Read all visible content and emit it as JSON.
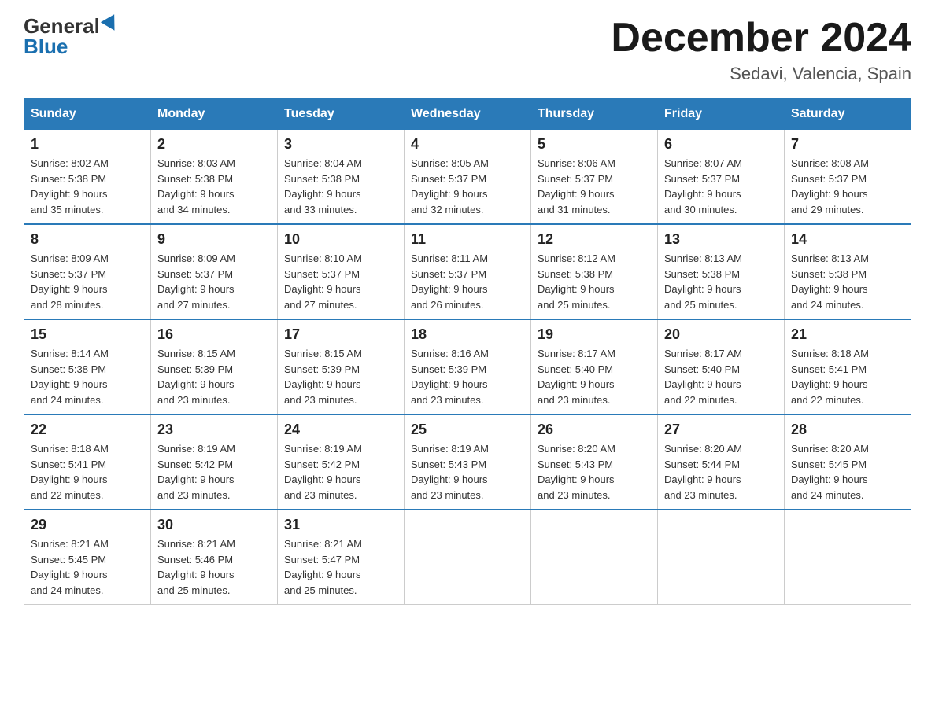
{
  "logo": {
    "general": "General",
    "blue": "Blue"
  },
  "title": {
    "month_year": "December 2024",
    "location": "Sedavi, Valencia, Spain"
  },
  "headers": [
    "Sunday",
    "Monday",
    "Tuesday",
    "Wednesday",
    "Thursday",
    "Friday",
    "Saturday"
  ],
  "weeks": [
    [
      {
        "num": "1",
        "sunrise": "8:02 AM",
        "sunset": "5:38 PM",
        "daylight": "9 hours and 35 minutes."
      },
      {
        "num": "2",
        "sunrise": "8:03 AM",
        "sunset": "5:38 PM",
        "daylight": "9 hours and 34 minutes."
      },
      {
        "num": "3",
        "sunrise": "8:04 AM",
        "sunset": "5:38 PM",
        "daylight": "9 hours and 33 minutes."
      },
      {
        "num": "4",
        "sunrise": "8:05 AM",
        "sunset": "5:37 PM",
        "daylight": "9 hours and 32 minutes."
      },
      {
        "num": "5",
        "sunrise": "8:06 AM",
        "sunset": "5:37 PM",
        "daylight": "9 hours and 31 minutes."
      },
      {
        "num": "6",
        "sunrise": "8:07 AM",
        "sunset": "5:37 PM",
        "daylight": "9 hours and 30 minutes."
      },
      {
        "num": "7",
        "sunrise": "8:08 AM",
        "sunset": "5:37 PM",
        "daylight": "9 hours and 29 minutes."
      }
    ],
    [
      {
        "num": "8",
        "sunrise": "8:09 AM",
        "sunset": "5:37 PM",
        "daylight": "9 hours and 28 minutes."
      },
      {
        "num": "9",
        "sunrise": "8:09 AM",
        "sunset": "5:37 PM",
        "daylight": "9 hours and 27 minutes."
      },
      {
        "num": "10",
        "sunrise": "8:10 AM",
        "sunset": "5:37 PM",
        "daylight": "9 hours and 27 minutes."
      },
      {
        "num": "11",
        "sunrise": "8:11 AM",
        "sunset": "5:37 PM",
        "daylight": "9 hours and 26 minutes."
      },
      {
        "num": "12",
        "sunrise": "8:12 AM",
        "sunset": "5:38 PM",
        "daylight": "9 hours and 25 minutes."
      },
      {
        "num": "13",
        "sunrise": "8:13 AM",
        "sunset": "5:38 PM",
        "daylight": "9 hours and 25 minutes."
      },
      {
        "num": "14",
        "sunrise": "8:13 AM",
        "sunset": "5:38 PM",
        "daylight": "9 hours and 24 minutes."
      }
    ],
    [
      {
        "num": "15",
        "sunrise": "8:14 AM",
        "sunset": "5:38 PM",
        "daylight": "9 hours and 24 minutes."
      },
      {
        "num": "16",
        "sunrise": "8:15 AM",
        "sunset": "5:39 PM",
        "daylight": "9 hours and 23 minutes."
      },
      {
        "num": "17",
        "sunrise": "8:15 AM",
        "sunset": "5:39 PM",
        "daylight": "9 hours and 23 minutes."
      },
      {
        "num": "18",
        "sunrise": "8:16 AM",
        "sunset": "5:39 PM",
        "daylight": "9 hours and 23 minutes."
      },
      {
        "num": "19",
        "sunrise": "8:17 AM",
        "sunset": "5:40 PM",
        "daylight": "9 hours and 23 minutes."
      },
      {
        "num": "20",
        "sunrise": "8:17 AM",
        "sunset": "5:40 PM",
        "daylight": "9 hours and 22 minutes."
      },
      {
        "num": "21",
        "sunrise": "8:18 AM",
        "sunset": "5:41 PM",
        "daylight": "9 hours and 22 minutes."
      }
    ],
    [
      {
        "num": "22",
        "sunrise": "8:18 AM",
        "sunset": "5:41 PM",
        "daylight": "9 hours and 22 minutes."
      },
      {
        "num": "23",
        "sunrise": "8:19 AM",
        "sunset": "5:42 PM",
        "daylight": "9 hours and 23 minutes."
      },
      {
        "num": "24",
        "sunrise": "8:19 AM",
        "sunset": "5:42 PM",
        "daylight": "9 hours and 23 minutes."
      },
      {
        "num": "25",
        "sunrise": "8:19 AM",
        "sunset": "5:43 PM",
        "daylight": "9 hours and 23 minutes."
      },
      {
        "num": "26",
        "sunrise": "8:20 AM",
        "sunset": "5:43 PM",
        "daylight": "9 hours and 23 minutes."
      },
      {
        "num": "27",
        "sunrise": "8:20 AM",
        "sunset": "5:44 PM",
        "daylight": "9 hours and 23 minutes."
      },
      {
        "num": "28",
        "sunrise": "8:20 AM",
        "sunset": "5:45 PM",
        "daylight": "9 hours and 24 minutes."
      }
    ],
    [
      {
        "num": "29",
        "sunrise": "8:21 AM",
        "sunset": "5:45 PM",
        "daylight": "9 hours and 24 minutes."
      },
      {
        "num": "30",
        "sunrise": "8:21 AM",
        "sunset": "5:46 PM",
        "daylight": "9 hours and 25 minutes."
      },
      {
        "num": "31",
        "sunrise": "8:21 AM",
        "sunset": "5:47 PM",
        "daylight": "9 hours and 25 minutes."
      },
      null,
      null,
      null,
      null
    ]
  ]
}
